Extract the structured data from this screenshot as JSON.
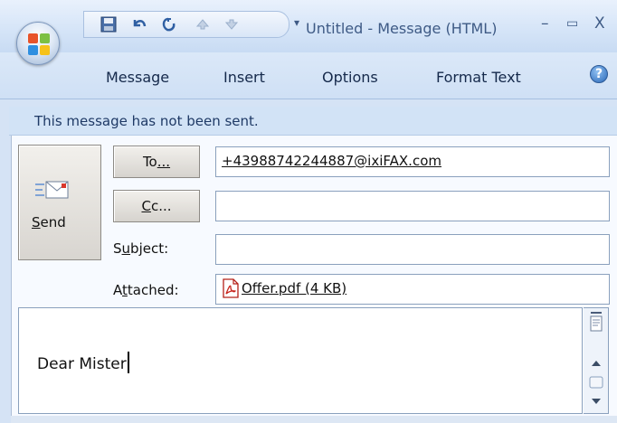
{
  "window": {
    "title": "Untitled - Message (HTML)",
    "minimize_label": "–",
    "maximize_label": "▭",
    "close_label": "X"
  },
  "quick_access": {
    "save_icon": "save-icon",
    "undo_icon": "undo-icon",
    "redo_icon": "redo-icon",
    "up_icon": "arrow-up-icon",
    "down_icon": "arrow-down-icon",
    "customize_icon": "customize-qat-icon",
    "separator": "▾"
  },
  "ribbon": {
    "tabs": [
      {
        "label": "Message"
      },
      {
        "label": "Insert"
      },
      {
        "label": "Options"
      },
      {
        "label": "Format Text"
      }
    ],
    "help_label": "?"
  },
  "info_bar": {
    "text": "This message has not been sent."
  },
  "send": {
    "label_prefix": "S",
    "label_rest": "end"
  },
  "to": {
    "button_prefix": "To",
    "button_ellipsis": "...",
    "value": "+43988742244887@ixiFAX.com"
  },
  "cc": {
    "button_prefix": "C",
    "button_rest": "c...",
    "value": ""
  },
  "subject": {
    "label_prefix": "S",
    "label_u": "u",
    "label_rest": "bject:",
    "value": ""
  },
  "attached": {
    "label_prefix": "A",
    "label_u": "t",
    "label_rest": "tached:",
    "file_label": "Offer.pdf (4 KB)"
  },
  "body": {
    "text": "Dear Mister"
  },
  "colors": {
    "accent": "#2a68b8",
    "window_bg": "#d5e3f5",
    "info_bar": "#d2e3f6"
  }
}
